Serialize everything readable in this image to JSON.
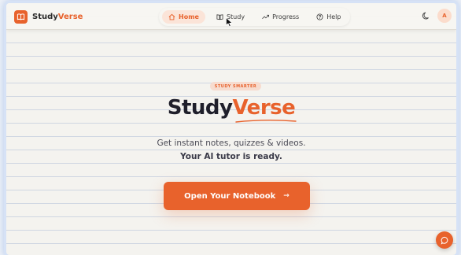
{
  "header": {
    "logo": {
      "part1": "Study",
      "part2": "Verse"
    },
    "nav": [
      {
        "label": "Home",
        "icon": "home-icon",
        "active": true
      },
      {
        "label": "Study",
        "icon": "book-icon",
        "active": false
      },
      {
        "label": "Progress",
        "icon": "trend-icon",
        "active": false
      },
      {
        "label": "Help",
        "icon": "help-icon",
        "active": false
      }
    ],
    "theme_icon": "moon-icon",
    "avatar_initial": "A"
  },
  "hero": {
    "pill": "STUDY SMARTER",
    "title_part1": "Study",
    "title_part2": "Verse",
    "tagline": "Get instant notes, quizzes & videos.",
    "subtagline": "Your AI tutor is ready.",
    "cta_label": "Open Your Notebook",
    "cta_arrow": "→"
  },
  "chat": {
    "icon": "chat-bubble-icon"
  },
  "colors": {
    "accent": "#e8622c",
    "text_dark": "#1f1f2b",
    "background": "#f4f3ef"
  }
}
